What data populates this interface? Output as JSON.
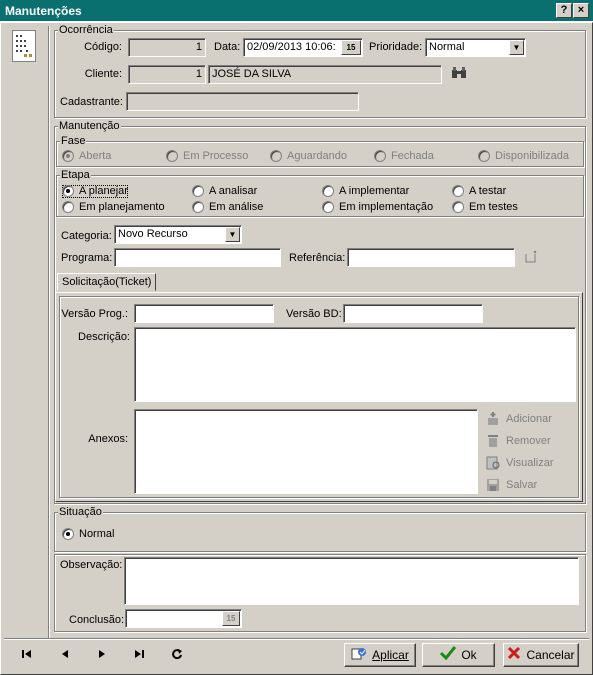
{
  "window": {
    "title": "Manutenções",
    "help_label": "?",
    "close_label": "×"
  },
  "ocorrencia": {
    "legend": "Ocorrência",
    "codigo_label": "Código:",
    "codigo_value": "1",
    "data_label": "Data:",
    "data_value": "02/09/2013 10:06:",
    "calendar_label": "15",
    "prioridade_label": "Prioridade:",
    "prioridade_value": "Normal",
    "cliente_label": "Cliente:",
    "cliente_code": "1",
    "cliente_name": "JOSÉ DA SILVA",
    "cadastrante_label": "Cadastrante:",
    "cadastrante_value": ""
  },
  "manutencao": {
    "legend": "Manutenção",
    "fase": {
      "legend": "Fase",
      "options": [
        "Aberta",
        "Em Processo",
        "Aguardando",
        "Fechada",
        "Disponibilizada"
      ],
      "selected": "Aberta"
    },
    "etapa": {
      "legend": "Etapa",
      "options": [
        "A planejar",
        "A analisar",
        "A implementar",
        "A testar",
        "Em planejamento",
        "Em análise",
        "Em implementação",
        "Em testes"
      ],
      "selected": "A planejar"
    },
    "categoria_label": "Categoria:",
    "categoria_value": "Novo Recurso",
    "programa_label": "Programa:",
    "programa_value": "",
    "referencia_label": "Referência:",
    "referencia_value": ""
  },
  "tabs": [
    {
      "label": "Solicitação(Ticket)",
      "active": true
    }
  ],
  "ticket": {
    "versao_prog_label": "Versão Prog.:",
    "versao_prog_value": "",
    "versao_bd_label": "Versão BD:",
    "versao_bd_value": "",
    "descricao_label": "Descrição:",
    "descricao_value": "",
    "anexos_label": "Anexos:",
    "anexo_actions": [
      "Adicionar",
      "Remover",
      "Visualizar",
      "Salvar"
    ]
  },
  "situacao": {
    "legend": "Situação",
    "options": [
      "Normal"
    ],
    "selected": "Normal"
  },
  "observacao_label": "Observação:",
  "observacao_value": "",
  "conclusao_label": "Conclusão:",
  "conclusao_value": "",
  "navigation": {
    "icons": [
      "first-record-icon",
      "previous-record-icon",
      "next-record-icon",
      "last-record-icon",
      "refresh-icon"
    ]
  },
  "buttons": {
    "apply": "Aplicar",
    "ok": "Ok",
    "cancel": "Cancelar"
  },
  "colors": {
    "titlebar": "#0a6f6f",
    "face": "#d4d0c8",
    "ok_check": "#1a8a1a",
    "cancel_x": "#c81e1e"
  }
}
